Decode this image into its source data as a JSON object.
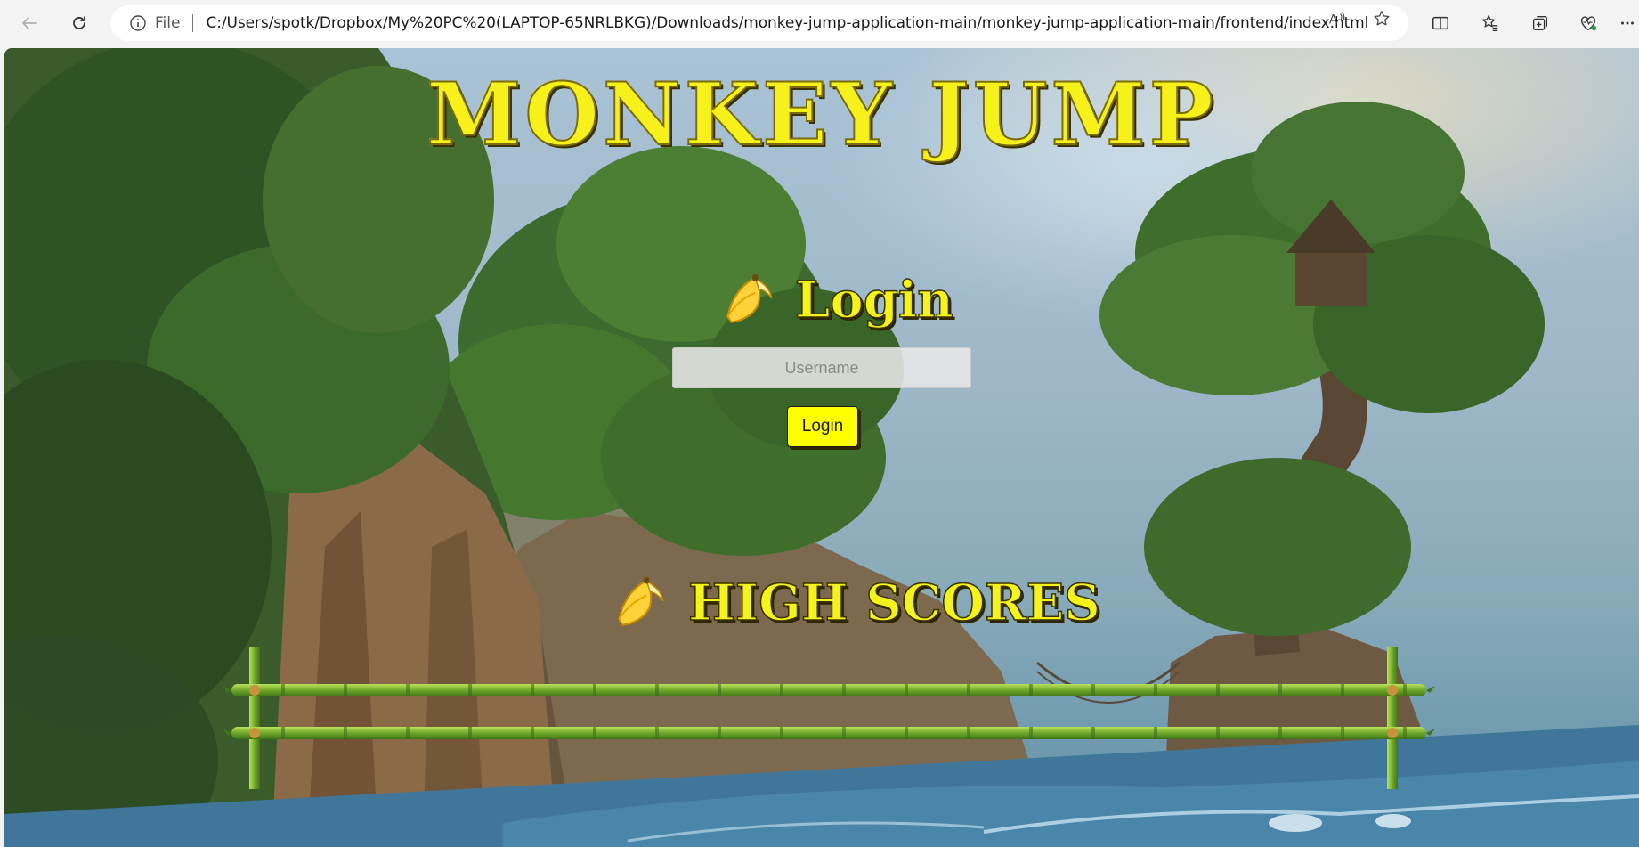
{
  "browser": {
    "file_label": "File",
    "url": "C:/Users/spotk/Dropbox/My%20PC%20(LAPTOP-65NRLBKG)/Downloads/monkey-jump-application-main/monkey-jump-application-main/frontend/index.html",
    "icons": [
      "back-icon",
      "refresh-icon",
      "info-icon",
      "read-aloud-icon",
      "favorite-star-icon",
      "split-screen-icon",
      "favorites-icon",
      "collections-icon",
      "browser-essentials-icon",
      "more-icon"
    ]
  },
  "page": {
    "title": "MONKEY JUMP",
    "login": {
      "heading": "Login",
      "username_placeholder": "Username",
      "username_value": "",
      "button_label": "Login"
    },
    "high_scores": {
      "heading": "HIGH SCORES"
    }
  },
  "colors": {
    "title_yellow": "#f6f11a",
    "button_yellow": "#ffff00",
    "bamboo_green": "#6fa82a"
  }
}
